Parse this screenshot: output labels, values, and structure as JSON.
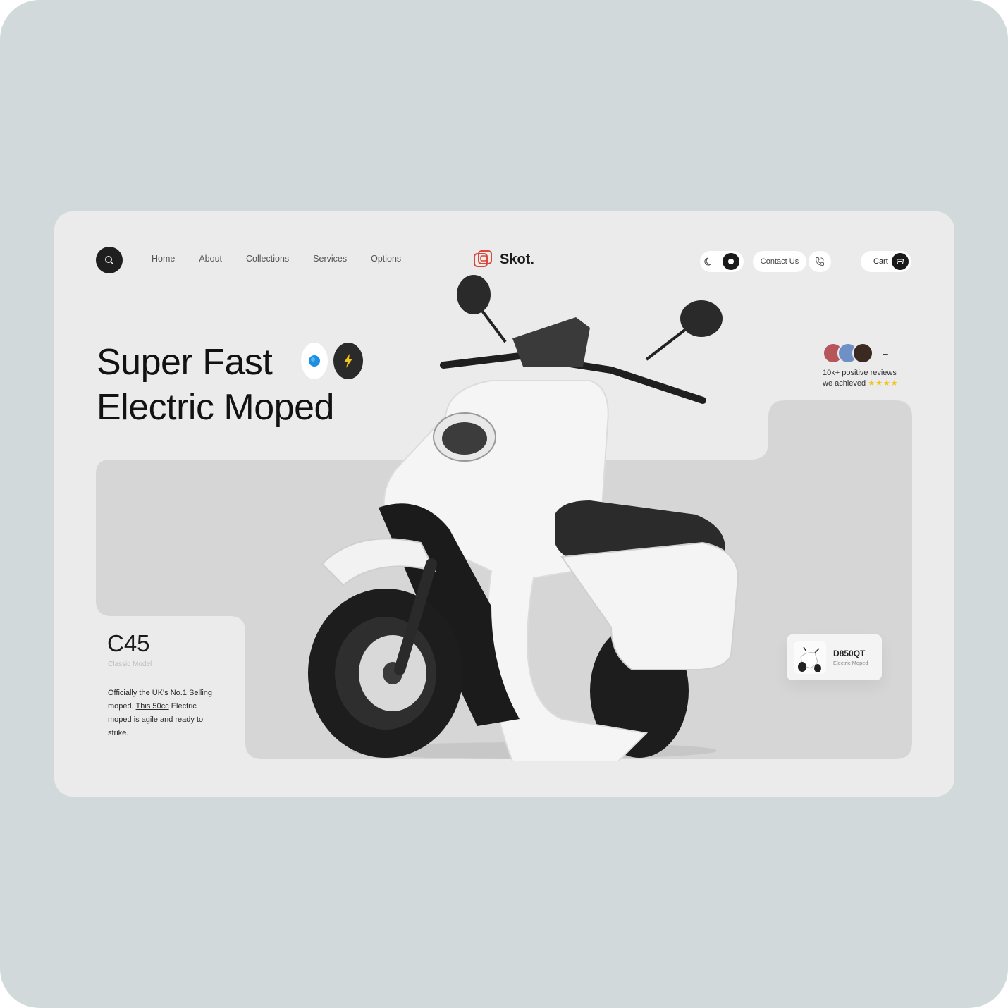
{
  "brand": {
    "name": "Skot."
  },
  "nav": {
    "items": [
      {
        "label": "Home"
      },
      {
        "label": "About"
      },
      {
        "label": "Collections"
      },
      {
        "label": "Services"
      },
      {
        "label": "Options"
      }
    ]
  },
  "actions": {
    "contact_label": "Contact Us",
    "cart_label": "Cart"
  },
  "hero": {
    "title_line1": "Super Fast",
    "title_line2": "Electric Moped"
  },
  "reviews": {
    "more": "–",
    "text_line1": "10k+ positive reviews",
    "text_line2": "we achieved",
    "stars": "★★★★"
  },
  "model": {
    "name": "C45",
    "subtitle": "Classic Model",
    "desc_part1": "Officially the UK's No.1 Selling moped.",
    "desc_link": "This 50cc",
    "desc_part2": "Electric moped is agile and ready to strike."
  },
  "product_card": {
    "name": "D850QT",
    "subtitle": "Electric Moped"
  },
  "icons": {
    "search": "search-icon",
    "moon": "moon-icon",
    "sun": "sun-icon",
    "phone": "phone-icon",
    "cart": "cart-icon",
    "logo": "logo-icon",
    "speed": "speed-icon",
    "bolt": "bolt-icon"
  },
  "colors": {
    "background": "#d2d9db",
    "card": "#ebebeb",
    "panel": "#d6d6d6",
    "dark": "#1f1f1f",
    "logo_accent": "#d9483b",
    "speed_blue": "#1c8fe0",
    "bolt_yellow": "#f5c518",
    "stars": "#f4c21a"
  }
}
